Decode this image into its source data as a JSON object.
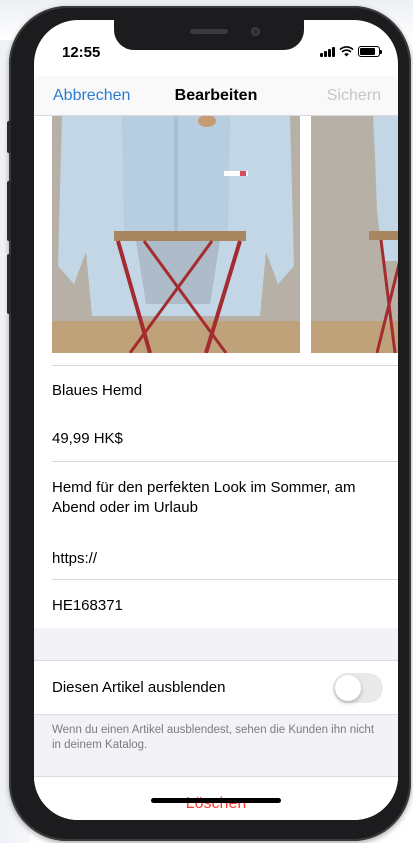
{
  "status_bar": {
    "time": "12:55"
  },
  "nav": {
    "cancel_label": "Abbrechen",
    "title": "Bearbeiten",
    "save_label": "Sichern"
  },
  "form": {
    "name": "Blaues Hemd",
    "price": "49,99 HK$",
    "description": "Hemd für den perfekten Look im Sommer, am Abend oder im Urlaub",
    "url": "https://",
    "item_id": "HE168371"
  },
  "hide_item": {
    "label": "Diesen Artikel ausblenden",
    "enabled": false,
    "hint": "Wenn du einen Artikel ausblendest, sehen die Kunden ihn nicht in deinem Katalog."
  },
  "delete_label": "Löschen",
  "colors": {
    "accent": "#2D7BD2",
    "destructive": "#FF3B30",
    "disabled": "#C5C6CA"
  }
}
